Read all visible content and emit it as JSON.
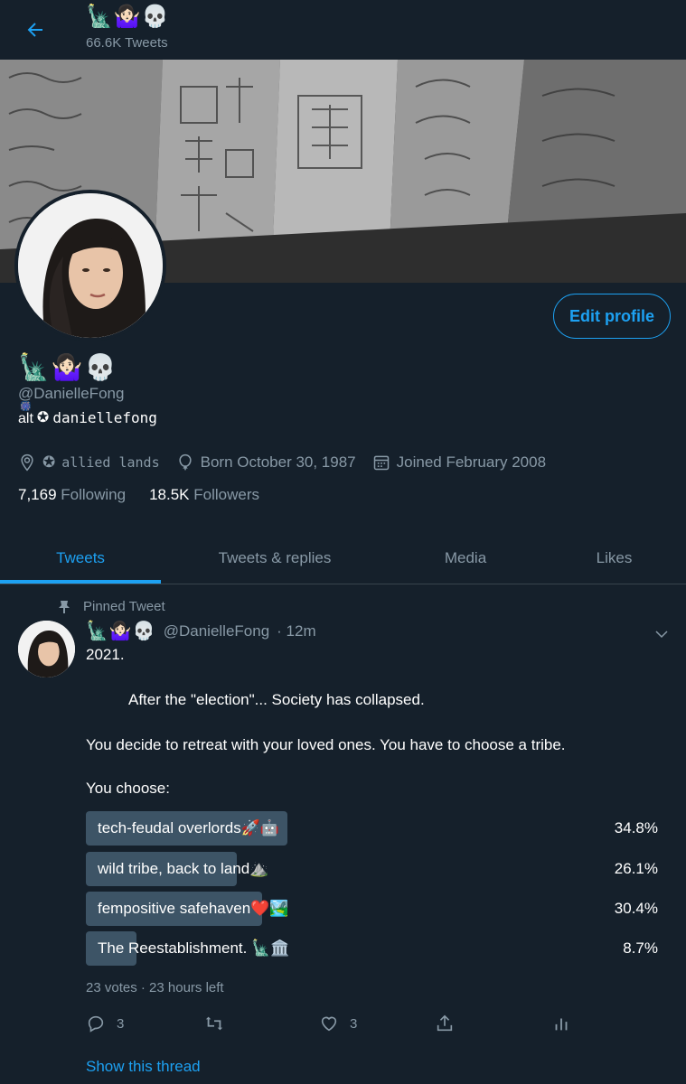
{
  "header": {
    "display_name": "🗽🤷🏻‍♀️💀",
    "tweet_count": "66.6K Tweets"
  },
  "profile": {
    "display_name": "🗽🤷🏻‍♀️💀",
    "handle": "@DanielleFong",
    "bio_prefix": "alt",
    "bio_sup": "🎆",
    "bio_symbol": "✪",
    "bio_name": "daniellefong",
    "edit_button": "Edit profile",
    "location_symbol": "✪",
    "location": "allied lands",
    "birthday": "Born October 30, 1987",
    "joined": "Joined February 2008",
    "following_count": "7,169",
    "following_label": "Following",
    "followers_count": "18.5K",
    "followers_label": "Followers"
  },
  "tabs": [
    {
      "label": "Tweets"
    },
    {
      "label": "Tweets & replies"
    },
    {
      "label": "Media"
    },
    {
      "label": "Likes"
    }
  ],
  "tweet": {
    "pinned_label": "Pinned Tweet",
    "author_emoji": "🗽🤷🏻‍♀️💀",
    "author_handle": "@DanielleFong",
    "time": "· 12m",
    "lines": [
      "2021.",
      "After the \"election\"... Society has collapsed.",
      "You decide to retreat with your loved ones. You have to choose a tribe.",
      "You choose:"
    ],
    "poll": [
      {
        "label": "tech-feudal overlords🚀🤖",
        "percent_label": "34.8%",
        "percent": 34.8
      },
      {
        "label": "wild tribe, back to land⛰️",
        "percent_label": "26.1%",
        "percent": 26.1
      },
      {
        "label": "fempositive safehaven❤️🏞️",
        "percent_label": "30.4%",
        "percent": 30.4
      },
      {
        "label": "The Reestablishment. 🗽🏛️",
        "percent_label": "8.7%",
        "percent": 8.7
      }
    ],
    "poll_meta": "23 votes · 23 hours left",
    "reply_count": "3",
    "like_count": "3",
    "show_thread": "Show this thread"
  },
  "colors": {
    "background": "#15202b",
    "accent": "#1da1f2",
    "muted": "#8899a6",
    "poll_bar": "#3d5466",
    "divider": "#38444d"
  }
}
